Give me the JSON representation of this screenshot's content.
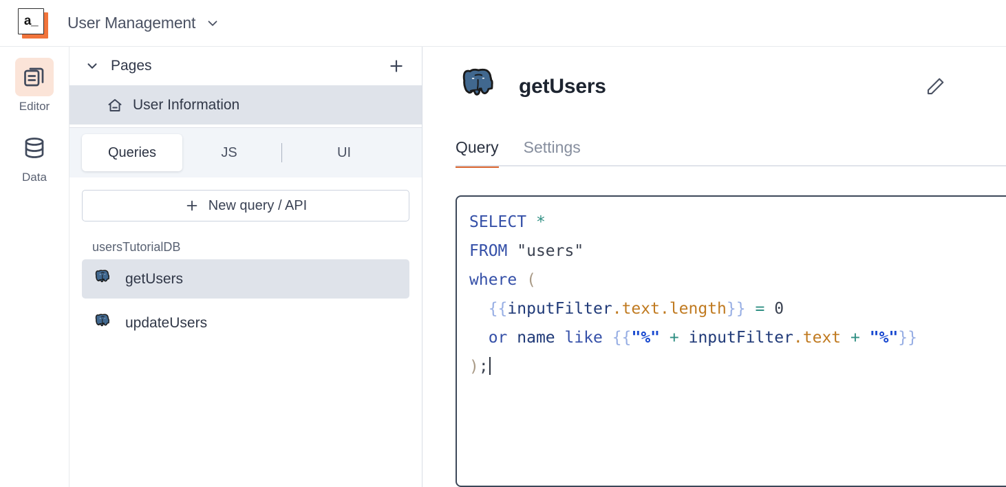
{
  "header": {
    "logo_text": "a_",
    "logo_icon": "appsmith-logo-icon",
    "app_title": "User Management",
    "chevron_icon": "chevron-down-icon",
    "accent_color": "#f1743b"
  },
  "rail": {
    "items": [
      {
        "label": "Editor",
        "icon": "pages-editor-icon",
        "active": true
      },
      {
        "label": "Data",
        "icon": "database-icon",
        "active": false
      }
    ]
  },
  "explorer": {
    "pages_section": {
      "title": "Pages",
      "collapse_icon": "chevron-down-icon",
      "add_icon": "plus-icon"
    },
    "pages": [
      {
        "label": "User Information",
        "icon": "home-icon",
        "selected": true
      }
    ],
    "tabs": [
      {
        "label": "Queries",
        "active": true
      },
      {
        "label": "JS",
        "active": false
      },
      {
        "label": "UI",
        "active": false
      }
    ],
    "new_query_button": {
      "label": "New query / API",
      "icon": "plus-icon"
    },
    "datasource_group": "usersTutorialDB",
    "queries": [
      {
        "label": "getUsers",
        "icon": "postgresql-icon",
        "selected": true
      },
      {
        "label": "updateUsers",
        "icon": "postgresql-icon",
        "selected": false
      }
    ]
  },
  "main": {
    "query_icon": "postgresql-icon",
    "query_name": "getUsers",
    "edit_icon": "pencil-icon",
    "tabs": [
      {
        "label": "Query",
        "active": true
      },
      {
        "label": "Settings",
        "active": false
      }
    ],
    "active_tab_underline_color": "#d9622b",
    "editor": {
      "lines": [
        "SELECT *",
        "FROM \"users\"",
        "where (",
        "  {{inputFilter.text.length}} = 0",
        "  or name like {{\"%\" + inputFilter.text + \"%\"}}",
        ");"
      ],
      "language": "sql",
      "cursor_after": ");"
    }
  }
}
